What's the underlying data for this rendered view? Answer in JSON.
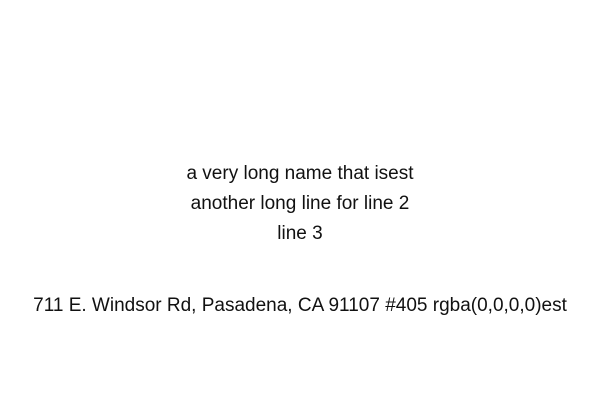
{
  "lines": [
    "a very long name that isest",
    "another long line for line 2",
    "line 3"
  ],
  "address": "711 E. Windsor Rd, Pasadena, CA 91107 #405 rgba(0,0,0,0)est",
  "colors": {
    "background": "#ffffff",
    "text": "#111111"
  }
}
